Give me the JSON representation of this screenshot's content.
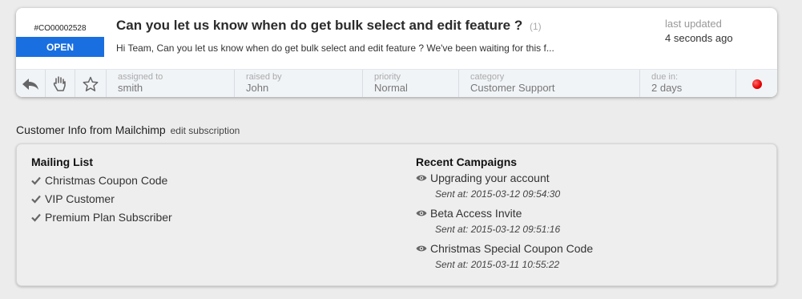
{
  "ticket": {
    "id": "#CO00002528",
    "status": "OPEN",
    "title": "Can you let us know when do get bulk select and edit feature ?",
    "count": "(1)",
    "preview": "Hi Team, Can you let us know when do get bulk select and edit feature ? We've been waiting for this f...",
    "last_updated_label": "last updated",
    "last_updated_value": "4 seconds ago",
    "status_color": "#1a6fe0"
  },
  "toolbar": {
    "actions": [
      {
        "icon": "reply-icon"
      },
      {
        "icon": "grab-hand-icon"
      },
      {
        "icon": "star-icon"
      }
    ],
    "fields": [
      {
        "label": "assigned to",
        "value": "smith"
      },
      {
        "label": "raised by",
        "value": "John"
      },
      {
        "label": "priority",
        "value": "Normal"
      },
      {
        "label": "category",
        "value": "Customer Support"
      },
      {
        "label": "due in:",
        "value": "2 days"
      }
    ],
    "indicator_color": "#e60000"
  },
  "mailchimp": {
    "title": "Customer Info from Mailchimp",
    "edit_link": "edit subscription",
    "mailing_list_title": "Mailing List",
    "mailing_list": [
      "Christmas Coupon Code",
      "VIP Customer",
      "Premium Plan Subscriber"
    ],
    "campaigns_title": "Recent Campaigns",
    "campaigns": [
      {
        "name": "Upgrading your account",
        "sent": "Sent at: 2015-03-12 09:54:30"
      },
      {
        "name": "Beta Access Invite",
        "sent": "Sent at: 2015-03-12 09:51:16"
      },
      {
        "name": "Christmas Special Coupon Code",
        "sent": "Sent at: 2015-03-11 10:55:22"
      }
    ]
  }
}
